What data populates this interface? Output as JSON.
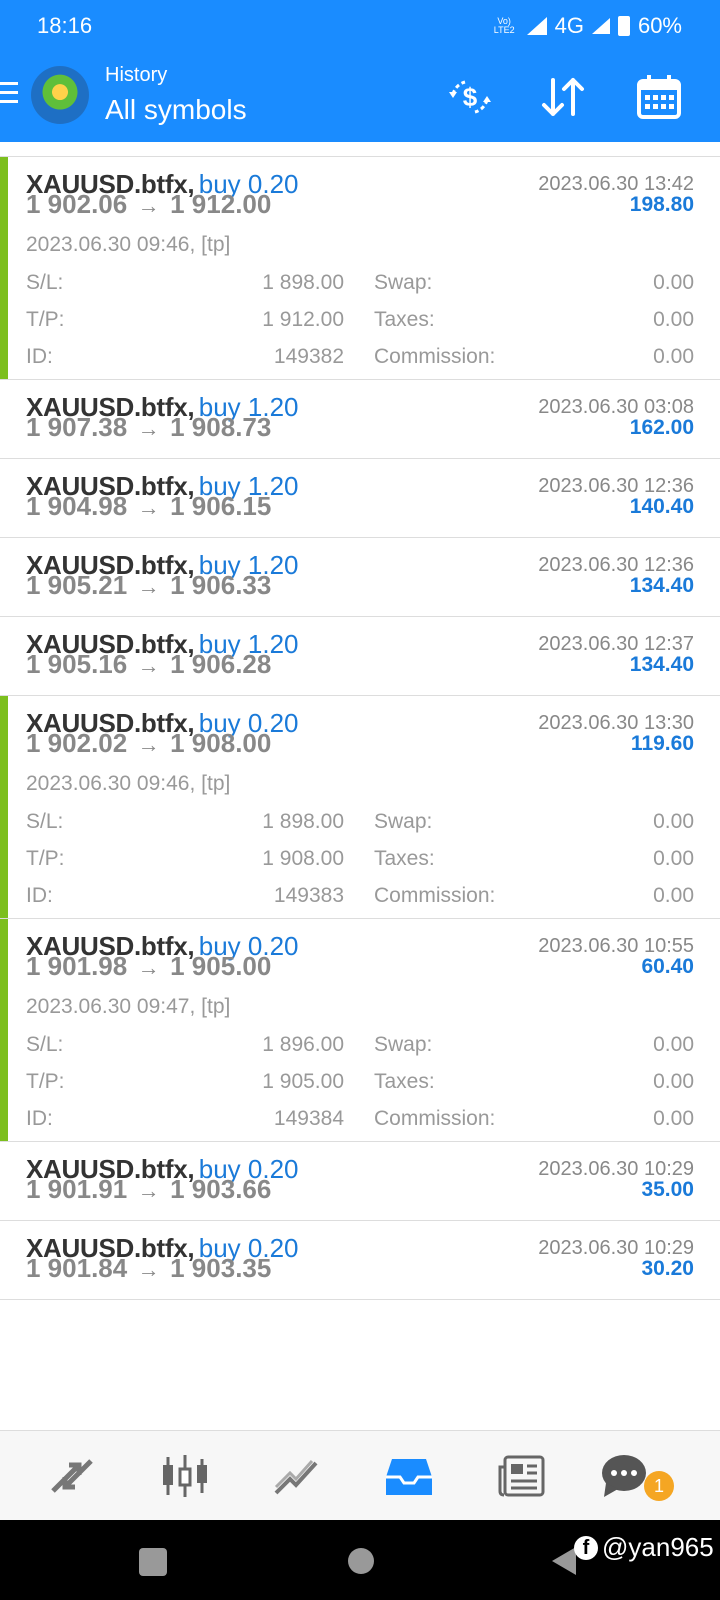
{
  "status_bar": {
    "time": "18:16",
    "network": "4G",
    "battery": "60%",
    "volte_line1": "Vo)",
    "volte_line2": "LTE2"
  },
  "header": {
    "title": "History",
    "subtitle": "All symbols"
  },
  "colors": {
    "accent": "#1a8cff",
    "profit": "#1a7ad9",
    "open_marker": "#7cbf1e"
  },
  "trades": [
    {
      "symbol": "XAUUSD.btfx,",
      "side": "buy 0.20",
      "close_time": "2023.06.30 13:42",
      "open_price": "1 902.06",
      "close_price": "1 912.00",
      "profit": "198.80",
      "expanded": true,
      "open_info": "2023.06.30 09:46, [tp]",
      "sl": "1 898.00",
      "tp": "1 912.00",
      "id": "149382",
      "swap": "0.00",
      "taxes": "0.00",
      "commission": "0.00"
    },
    {
      "symbol": "XAUUSD.btfx,",
      "side": "buy 1.20",
      "close_time": "2023.06.30 03:08",
      "open_price": "1 907.38",
      "close_price": "1 908.73",
      "profit": "162.00",
      "expanded": false
    },
    {
      "symbol": "XAUUSD.btfx,",
      "side": "buy 1.20",
      "close_time": "2023.06.30 12:36",
      "open_price": "1 904.98",
      "close_price": "1 906.15",
      "profit": "140.40",
      "expanded": false
    },
    {
      "symbol": "XAUUSD.btfx,",
      "side": "buy 1.20",
      "close_time": "2023.06.30 12:36",
      "open_price": "1 905.21",
      "close_price": "1 906.33",
      "profit": "134.40",
      "expanded": false
    },
    {
      "symbol": "XAUUSD.btfx,",
      "side": "buy 1.20",
      "close_time": "2023.06.30 12:37",
      "open_price": "1 905.16",
      "close_price": "1 906.28",
      "profit": "134.40",
      "expanded": false
    },
    {
      "symbol": "XAUUSD.btfx,",
      "side": "buy 0.20",
      "close_time": "2023.06.30 13:30",
      "open_price": "1 902.02",
      "close_price": "1 908.00",
      "profit": "119.60",
      "expanded": true,
      "open_info": "2023.06.30 09:46, [tp]",
      "sl": "1 898.00",
      "tp": "1 908.00",
      "id": "149383",
      "swap": "0.00",
      "taxes": "0.00",
      "commission": "0.00"
    },
    {
      "symbol": "XAUUSD.btfx,",
      "side": "buy 0.20",
      "close_time": "2023.06.30 10:55",
      "open_price": "1 901.98",
      "close_price": "1 905.00",
      "profit": "60.40",
      "expanded": true,
      "open_info": "2023.06.30 09:47, [tp]",
      "sl": "1 896.00",
      "tp": "1 905.00",
      "id": "149384",
      "swap": "0.00",
      "taxes": "0.00",
      "commission": "0.00"
    },
    {
      "symbol": "XAUUSD.btfx,",
      "side": "buy 0.20",
      "close_time": "2023.06.30 10:29",
      "open_price": "1 901.91",
      "close_price": "1 903.66",
      "profit": "35.00",
      "expanded": false
    },
    {
      "symbol": "XAUUSD.btfx,",
      "side": "buy 0.20",
      "close_time": "2023.06.30 10:29",
      "open_price": "1 901.84",
      "close_price": "1 903.35",
      "profit": "30.20",
      "expanded": false
    }
  ],
  "labels": {
    "sl": "S/L:",
    "tp": "T/P:",
    "id": "ID:",
    "swap": "Swap:",
    "taxes": "Taxes:",
    "commission": "Commission:",
    "arrow": "→"
  },
  "bottom_nav": {
    "items": [
      "quotes",
      "chart",
      "trade",
      "history",
      "news",
      "messages"
    ],
    "active": "history",
    "badge": "1"
  },
  "watermark": {
    "fb": "f",
    "handle": "@yan965"
  }
}
